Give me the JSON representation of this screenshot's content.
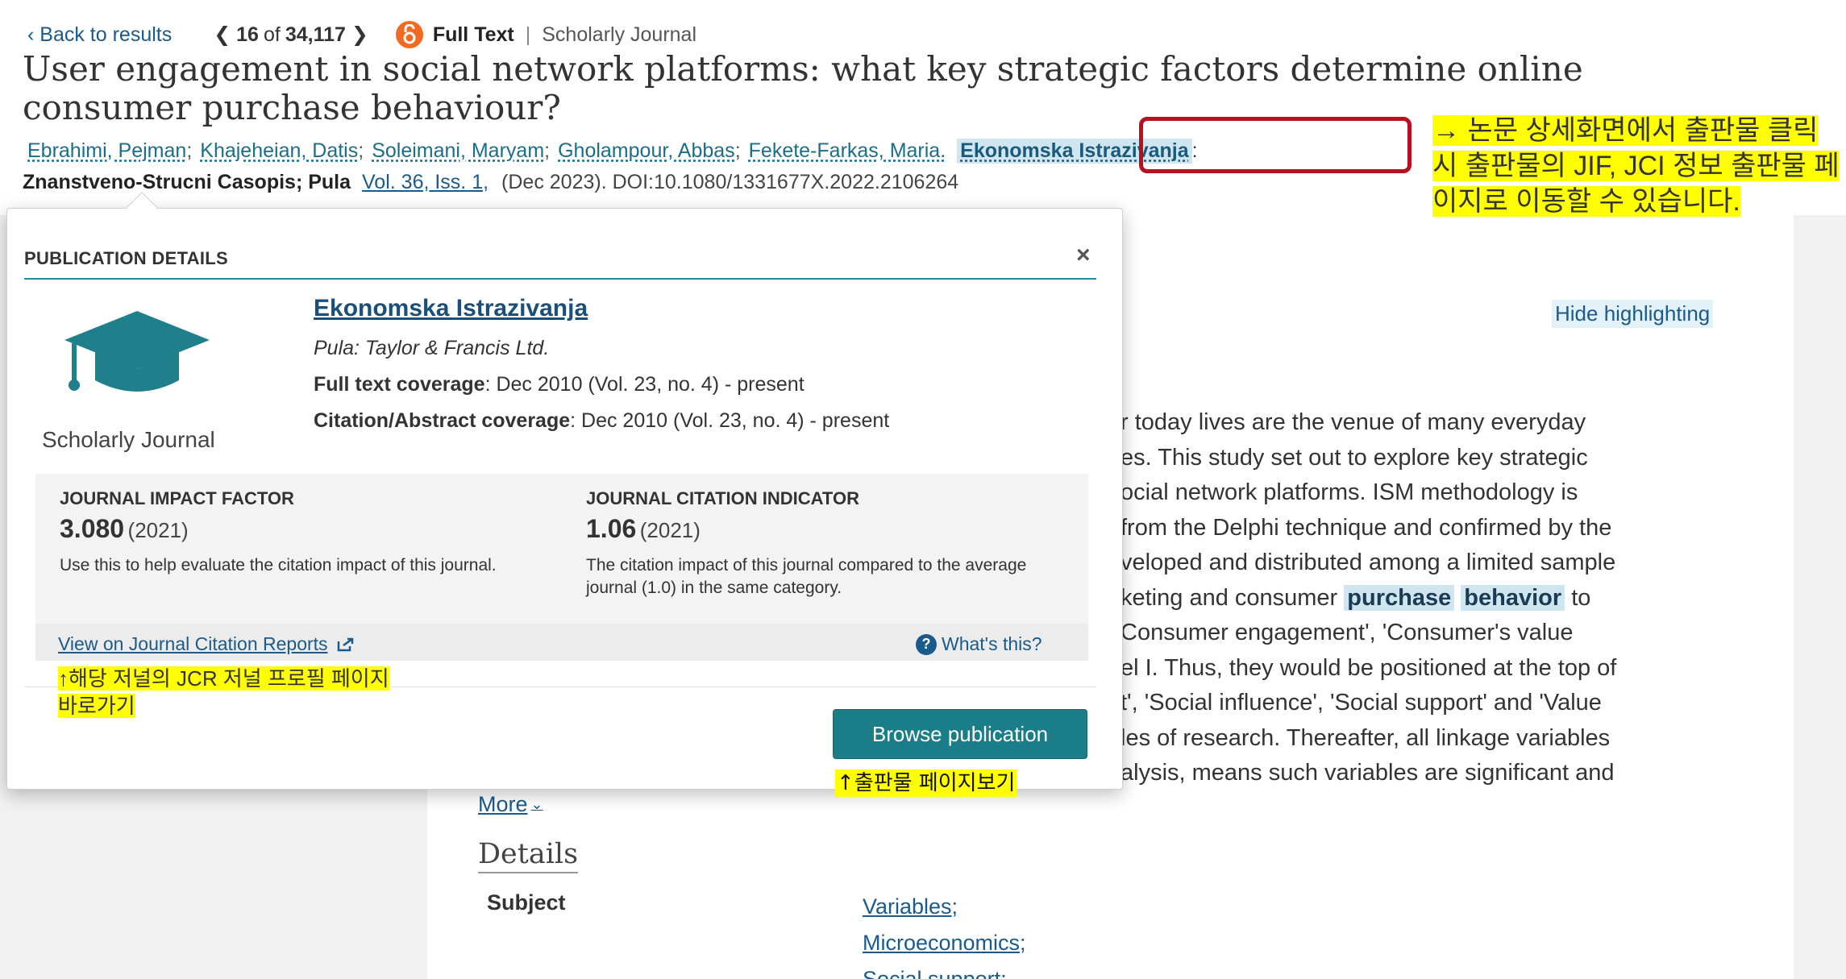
{
  "header": {
    "back_label": "Back to results",
    "current": "16",
    "of_word": "of",
    "total": "34,117",
    "full_text_label": "Full Text",
    "separator": "|",
    "doc_type": "Scholarly Journal"
  },
  "article": {
    "title": "User engagement in social network platforms: what key strategic factors determine online consumer purchase behaviour?",
    "authors": [
      "Ebrahimi, Pejman",
      "Khajeheian, Datis",
      "Soleimani, Maryam",
      "Gholampour, Abbas",
      "Fekete-Farkas, Maria."
    ],
    "journal_link": "Ekonomska Istrazivanja",
    "journal_suffix": ":",
    "pub_line_bold": "Znanstveno-Strucni Casopis; Pula",
    "volume": "Vol. 36, Iss. 1,",
    "date_doi": "(Dec 2023). DOI:10.1080/1331677X.2022.2106264"
  },
  "abstract": {
    "hide_highlighting": "Hide highlighting",
    "lines": [
      "r today lives are the venue of many everyday",
      "es. This study set out to explore key strategic",
      "ocial network platforms. ISM methodology is",
      "from the Delphi technique and confirmed by the",
      "veloped and distributed among a limited sample",
      "keting and consumer",
      "to",
      "Consumer engagement', 'Consumer's value",
      "el I. Thus, they would be positioned at the top of",
      "t', 'Social influence', 'Social support' and 'Value",
      "les of research. Thereafter, all linkage variables",
      "alysis, means such variables are significant and"
    ],
    "highlight_1": "purchase",
    "highlight_2": "behavior",
    "more_label": "More"
  },
  "details": {
    "heading": "Details",
    "subject_label": "Subject",
    "subjects": [
      "Variables;",
      "Microeconomics;",
      "Social support;"
    ]
  },
  "popover": {
    "heading": "PUBLICATION DETAILS",
    "close": "×",
    "type_label": "Scholarly Journal",
    "journal_name": "Ekonomska Istrazivanja",
    "publisher": "Pula: Taylor & Francis Ltd.",
    "full_text_label": "Full text coverage",
    "full_text_value": ": Dec 2010 (Vol. 23, no. 4) - present",
    "citation_label": "Citation/Abstract coverage",
    "citation_value": ": Dec 2010 (Vol. 23, no. 4) - present",
    "jif": {
      "title": "JOURNAL IMPACT FACTOR",
      "value": "3.080",
      "year": "(2021)",
      "desc": "Use this to help evaluate the citation impact of this journal."
    },
    "jci": {
      "title": "JOURNAL CITATION INDICATOR",
      "value": "1.06",
      "year": "(2021)",
      "desc": "The citation impact of this journal compared to the average journal (1.0) in the same category."
    },
    "jcr_link": "View on Journal Citation Reports",
    "whats_this": "What's this?",
    "browse_button": "Browse publication"
  },
  "annotations": {
    "top_note": "→ 논문 상세화면에서 출판물 클릭 시 출판물의 JIF, JCI 정보 출판물 페이지로 이동할 수 있습니다.",
    "jcr_note_line1": "↑해당 저널의 JCR 저널 프로필 페이지",
    "jcr_note_line2": "바로가기",
    "browse_note": "↑출판물 페이지보기"
  },
  "colors": {
    "link": "#1a5a8c",
    "teal_button": "#1b7d87",
    "open_access": "#f26a21",
    "annotation_box": "#b8111d",
    "highlight": "#ffff00"
  }
}
